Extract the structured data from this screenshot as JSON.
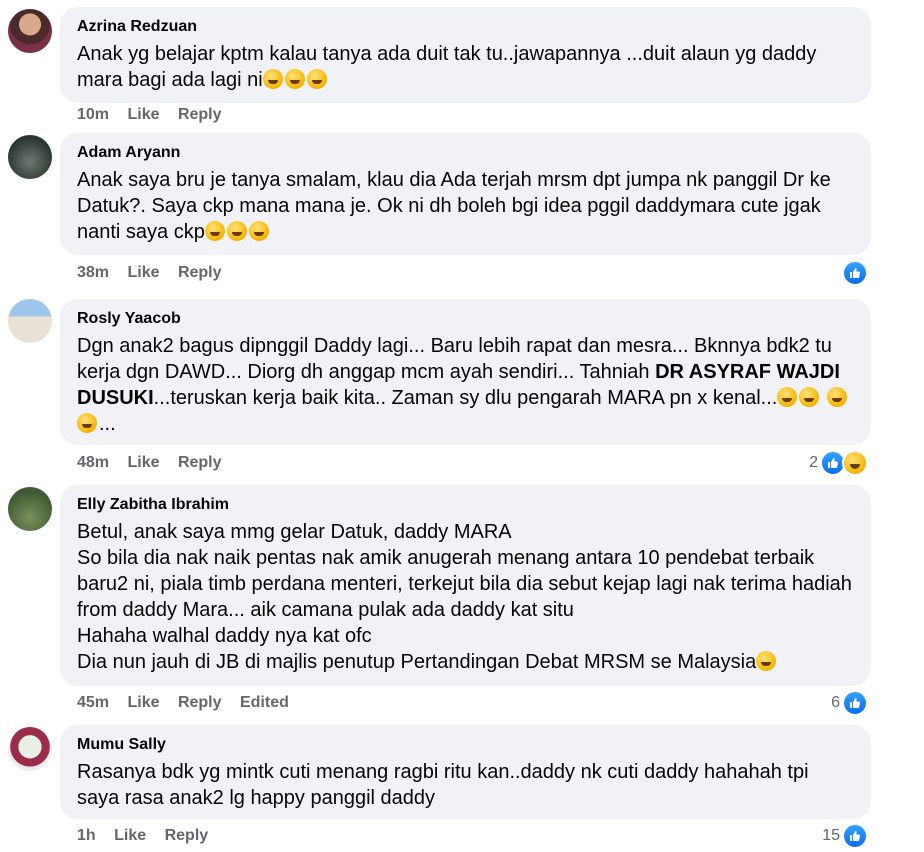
{
  "comments": [
    {
      "author": "Azrina Redzuan",
      "text": "Anak yg belajar kptm kalau tanya ada duit tak tu..jawapannya ...duit alaun yg daddy mara bagi ada lagi ni",
      "emoji_count": 3,
      "time": "10m",
      "like": "Like",
      "reply": "Reply",
      "reactions": null
    },
    {
      "author": "Adam Aryann",
      "text": "Anak saya bru je tanya smalam, klau dia Ada terjah mrsm dpt jumpa nk panggil Dr ke Datuk?. Saya ckp mana mana je. Ok ni dh boleh bgi idea pggil daddymara cute jgak nanti saya ckp",
      "emoji_count": 3,
      "time": "38m",
      "like": "Like",
      "reply": "Reply",
      "reactions": ""
    },
    {
      "author": "Rosly Yaacob",
      "text_a": "Dgn anak2 bagus dipnggil Daddy lagi... Baru lebih rapat dan mesra... Bknnya bdk2 tu kerja dgn DAWD... Diorg dh anggap mcm ayah sendiri... Tahniah ",
      "text_bold": "DR ASYRAF WAJDI DUSUKI",
      "text_b": "...teruskan kerja baik kita.. Zaman sy dlu pengarah MARA pn x kenal...",
      "text_c": "...",
      "time": "48m",
      "like": "Like",
      "reply": "Reply",
      "reactions": "2"
    },
    {
      "author": "Elly Zabitha Ibrahim",
      "lines": [
        "Betul, anak saya mmg gelar Datuk, daddy MARA",
        "So bila dia nak naik pentas nak amik anugerah menang antara 10 pendebat terbaik baru2 ni, piala timb perdana menteri, terkejut bila dia sebut kejap lagi nak terima hadiah from daddy Mara... aik camana pulak ada daddy kat situ",
        "Hahaha walhal daddy nya kat ofc",
        "Dia nun jauh di JB di majlis penutup Pertandingan Debat MRSM se Malaysia"
      ],
      "time": "45m",
      "like": "Like",
      "reply": "Reply",
      "edited": "Edited",
      "reactions": "6"
    },
    {
      "author": "Mumu Sally",
      "text": "Rasanya bdk yg mintk cuti menang ragbi ritu kan..daddy nk cuti daddy hahahah tpi saya rasa anak2 lg happy panggil daddy",
      "time": "1h",
      "like": "Like",
      "reply": "Reply",
      "reactions": "15"
    }
  ],
  "colors": {
    "bubble": "#f0f2f5",
    "meta": "#65676b",
    "like_blue": "#1877f2"
  }
}
